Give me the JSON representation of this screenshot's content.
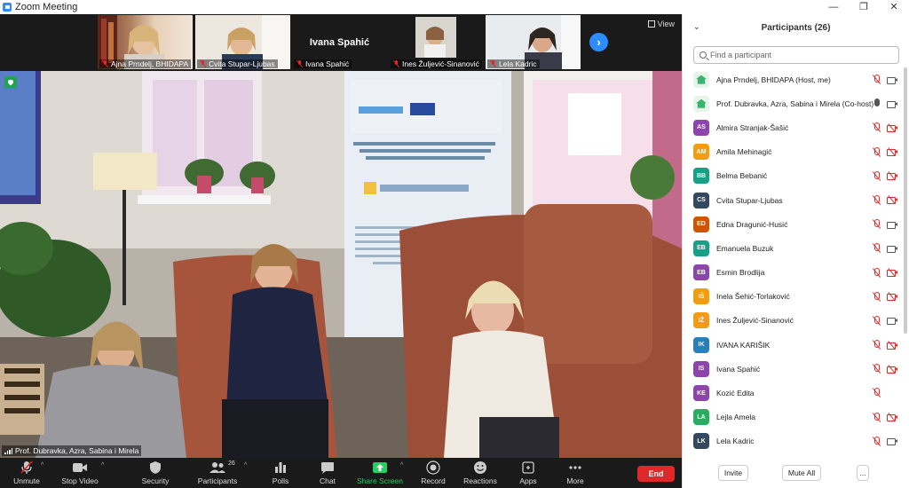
{
  "window": {
    "title": "Zoom Meeting",
    "controls": [
      "—",
      "❐",
      "✕"
    ]
  },
  "thumbnails": [
    {
      "name": "Ajna Prndelj, BHIDAPA",
      "muted": true
    },
    {
      "name": "Cvita Stupar-Ljubas",
      "muted": true
    },
    {
      "name": "Ivana Spahić",
      "muted": true,
      "card_text": "Ivana Spahić"
    },
    {
      "name": "Ines Žuljević-Sinanović",
      "muted": true
    },
    {
      "name": "Lela Kadric",
      "muted": true
    }
  ],
  "view_label": "View",
  "speaker": {
    "name": "Prof. Dubravka, Azra, Sabina i Mirela"
  },
  "toolbar": {
    "unmute": "Unmute",
    "stop_video": "Stop Video",
    "security": "Security",
    "participants": "Participants",
    "participants_count": "26",
    "polls": "Polls",
    "chat": "Chat",
    "share_screen": "Share Screen",
    "record": "Record",
    "reactions": "Reactions",
    "apps": "Apps",
    "more": "More",
    "end": "End"
  },
  "panel": {
    "title": "Participants (26)",
    "search_placeholder": "Find a participant",
    "invite": "Invite",
    "mute_all": "Mute All",
    "more": "...",
    "participants": [
      {
        "initials": "",
        "logo": true,
        "color": "#e7f4ea",
        "name": "Ajna Prndelj, BHIDAPA (Host, me)",
        "mic": "off",
        "cam": "on"
      },
      {
        "initials": "",
        "logo": true,
        "color": "#e7f4ea",
        "name": "Prof. Dubravka, Azra, Sabina i Mirela (Co-host)",
        "mic": "on",
        "cam": "on"
      },
      {
        "initials": "AS",
        "color": "#8e44ad",
        "name": "Almira Stranjak-Šašić",
        "mic": "off",
        "cam": "off"
      },
      {
        "initials": "AM",
        "color": "#f39c12",
        "name": "Amila Mehinagić",
        "mic": "off",
        "cam": "off"
      },
      {
        "initials": "BB",
        "color": "#16a085",
        "name": "Belma Bebanić",
        "mic": "off",
        "cam": "off"
      },
      {
        "initials": "CS",
        "color": "#34495e",
        "name": "Cvita Stupar-Ljubas",
        "mic": "off",
        "cam": "off"
      },
      {
        "initials": "ED",
        "color": "#d35400",
        "name": "Edna Dragunić-Husić",
        "mic": "off",
        "cam": "on"
      },
      {
        "initials": "EB",
        "color": "#16a085",
        "name": "Emanuela Buzuk",
        "mic": "off",
        "cam": "on"
      },
      {
        "initials": "EB",
        "color": "#8e44ad",
        "name": "Esmin Brodlija",
        "mic": "off",
        "cam": "off"
      },
      {
        "initials": "IŠ",
        "color": "#f39c12",
        "name": "Inela Šehić-Torlaković",
        "mic": "off",
        "cam": "off"
      },
      {
        "initials": "IŽ",
        "color": "#f39c12",
        "name": "Ines Žuljević-Sinanović",
        "mic": "off",
        "cam": "on"
      },
      {
        "initials": "IK",
        "color": "#2980b9",
        "name": "IVANA KARIŠIK",
        "mic": "off",
        "cam": "off"
      },
      {
        "initials": "IS",
        "color": "#8e44ad",
        "name": "Ivana Spahić",
        "mic": "off",
        "cam": "off"
      },
      {
        "initials": "KE",
        "color": "#8e44ad",
        "name": "Kozić Edita",
        "mic": "off",
        "cam": "none"
      },
      {
        "initials": "LA",
        "color": "#27ae60",
        "name": "Lejla Amela",
        "mic": "off",
        "cam": "off"
      },
      {
        "initials": "LK",
        "color": "#34495e",
        "name": "Lela Kadric",
        "mic": "off",
        "cam": "on"
      }
    ]
  }
}
